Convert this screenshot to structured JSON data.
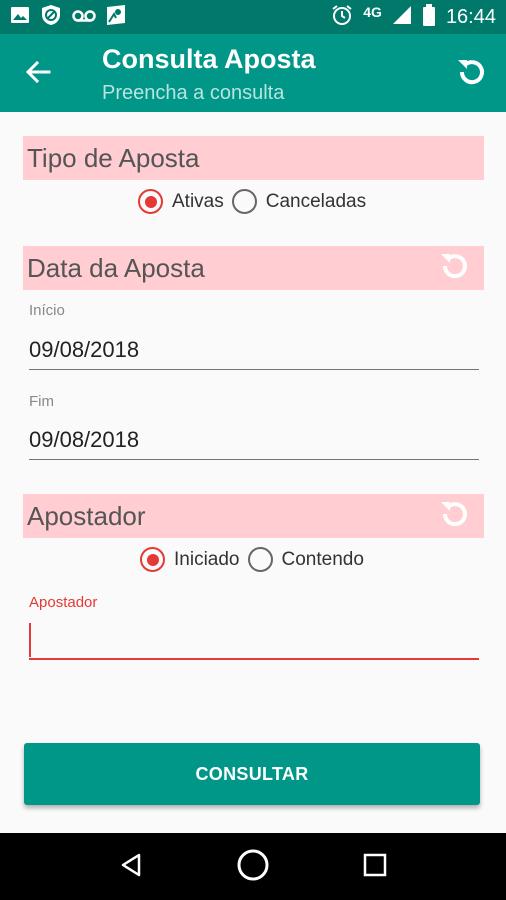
{
  "status_bar": {
    "time": "16:44",
    "network": "4G",
    "icons": [
      "image-icon",
      "blocked-icon",
      "voicemail-icon",
      "map-icon",
      "alarm-icon",
      "signal-icon",
      "battery-icon"
    ]
  },
  "app_bar": {
    "title": "Consulta Aposta",
    "subtitle": "Preencha a consulta",
    "icons": [
      "back-arrow-icon",
      "refresh-icon"
    ]
  },
  "sections": {
    "tipo": {
      "title": "Tipo de Aposta",
      "options": [
        {
          "label": "Ativas",
          "checked": true
        },
        {
          "label": "Canceladas",
          "checked": false
        }
      ]
    },
    "data": {
      "title": "Data da Aposta",
      "inicio_label": "Início",
      "inicio_value": "09/08/2018",
      "fim_label": "Fim",
      "fim_value": "09/08/2018"
    },
    "apostador": {
      "title": "Apostador",
      "options": [
        {
          "label": "Iniciado",
          "checked": true
        },
        {
          "label": "Contendo",
          "checked": false
        }
      ],
      "field_label": "Apostador",
      "field_value": ""
    }
  },
  "button": {
    "label": "CONSULTAR"
  },
  "colors": {
    "status_bar": "#00796b",
    "app_bar": "#009688",
    "section_bg": "#ffcdd2",
    "accent": "#e53935"
  }
}
